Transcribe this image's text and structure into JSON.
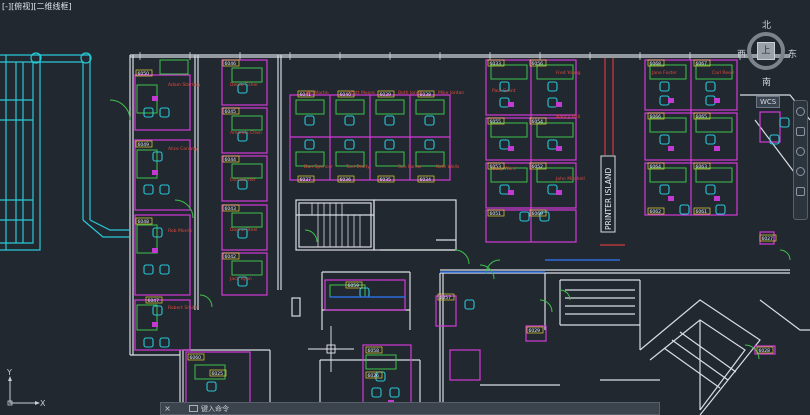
{
  "viewport": {
    "label": "[-][俯视][二维线框]"
  },
  "viewcube": {
    "north": "北",
    "south": "南",
    "east": "东",
    "west": "西",
    "face": "上"
  },
  "wcs": {
    "label": "WCS"
  },
  "ucs": {
    "x_label": "X",
    "y_label": "Y"
  },
  "command_line": {
    "placeholder": "键入命令"
  },
  "drawing": {
    "printer_island": "PRINTER ISLAND",
    "room_numbers": [
      "6050",
      "6049",
      "6048",
      "6047",
      "6046",
      "6045",
      "6044",
      "6043",
      "6042",
      "6041",
      "6040",
      "6039",
      "6038",
      "6037",
      "6036",
      "6035",
      "6034",
      "6033",
      "6056",
      "6055",
      "6054",
      "6053",
      "6052",
      "6051",
      "6069",
      "6068",
      "6067",
      "6066",
      "6065",
      "6064",
      "6063",
      "6062",
      "6061",
      "6060",
      "6059",
      "6058",
      "6057",
      "6029",
      "6028",
      "6027",
      "6026",
      "6025",
      "6024",
      "6023",
      "6022",
      "6021",
      "6020",
      "6019",
      "6018",
      "6017",
      "6016",
      "6015",
      "6014",
      "6013",
      "6012",
      "6011",
      "6010",
      "6009",
      "6008",
      "6007",
      "6006",
      "6005",
      "6004",
      "6003",
      "6002",
      "6001",
      "6070",
      "6071",
      "6072",
      "6073",
      "6074",
      "6075"
    ],
    "name_labels": [
      "Adam Sterling",
      "Alice Conway",
      "Rob Morris",
      "Robert Smith",
      "Derek Fisher",
      "Amanda Chen",
      "Lisa Hunter",
      "Donna Steel",
      "Jack Ryan",
      "Joe Martin",
      "Scott Moore",
      "Beth Jones",
      "Mike Jordan",
      "Dan Spencer",
      "Tom Brady",
      "Sue Parker",
      "Kate Wells",
      "Fred Young",
      "Paul Grant",
      "Nancy Hall",
      "Gary Ward",
      "John Mitchell",
      "Jane Foster",
      "Carl Reed"
    ]
  }
}
